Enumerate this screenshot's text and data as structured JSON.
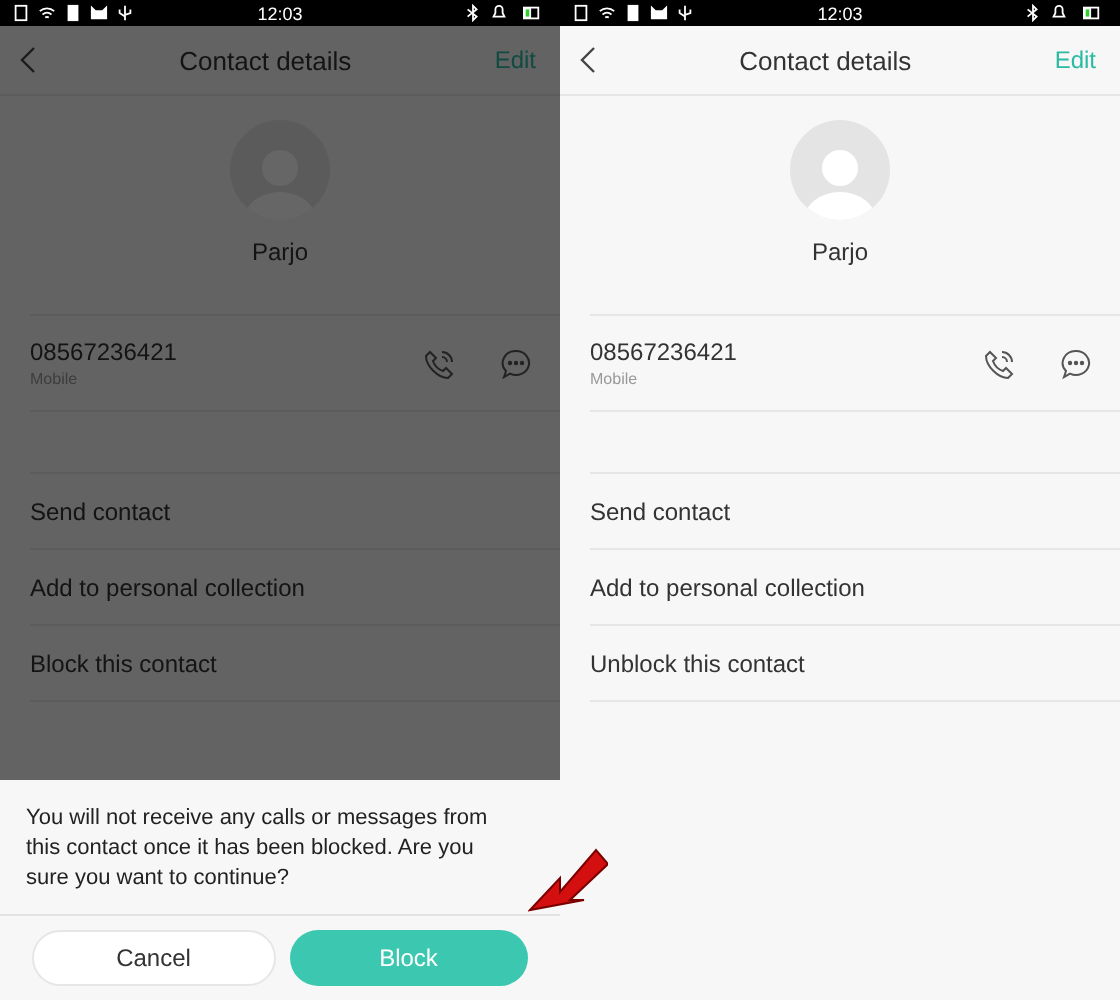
{
  "screens": [
    {
      "status_bar": {
        "time": "12:03"
      },
      "header": {
        "title": "Contact details",
        "action": "Edit"
      },
      "contact": {
        "name": "Parjo",
        "number": "08567236421",
        "number_type": "Mobile"
      },
      "actions": [
        "Send contact",
        "Add to personal collection",
        "Block this contact"
      ],
      "dialog": {
        "message": "You will not receive any calls or messages from this contact once it has been blocked. Are you sure you want to continue?",
        "buttons": [
          {
            "label": "Cancel",
            "kind": "secondary"
          },
          {
            "label": "Block",
            "kind": "primary"
          }
        ]
      }
    },
    {
      "status_bar": {
        "time": "12:03"
      },
      "header": {
        "title": "Contact details",
        "action": "Edit"
      },
      "contact": {
        "name": "Parjo",
        "number": "08567236421",
        "number_type": "Mobile"
      },
      "actions": [
        "Send contact",
        "Add to personal collection",
        "Unblock this contact"
      ]
    }
  ]
}
